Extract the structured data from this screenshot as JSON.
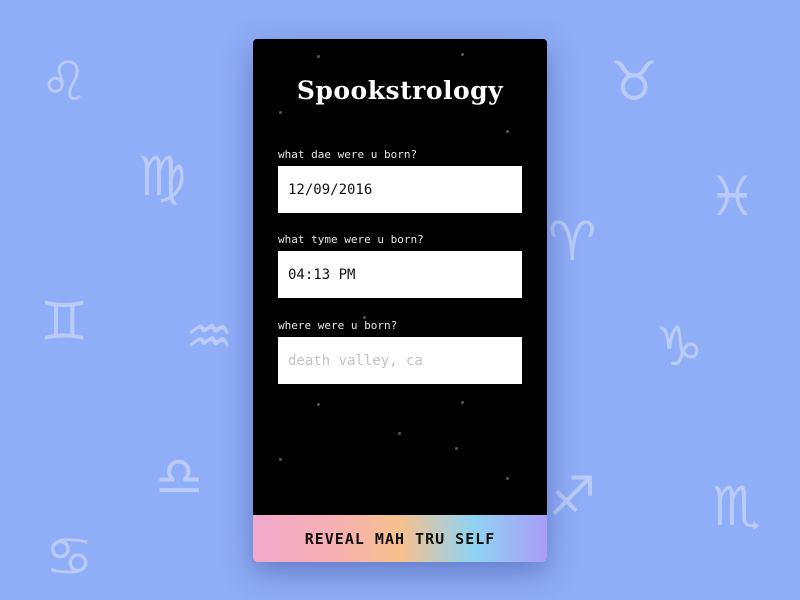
{
  "background": {
    "color": "#90adf7",
    "symbols": [
      {
        "name": "leo-icon",
        "glyph": "♌"
      },
      {
        "name": "virgo-icon",
        "glyph": "♍"
      },
      {
        "name": "gemini-icon",
        "glyph": "♊"
      },
      {
        "name": "aquarius-icon",
        "glyph": "♒"
      },
      {
        "name": "libra-icon",
        "glyph": "♎"
      },
      {
        "name": "cancer-icon",
        "glyph": "♋"
      },
      {
        "name": "taurus-icon",
        "glyph": "♉"
      },
      {
        "name": "pisces-icon",
        "glyph": "♓"
      },
      {
        "name": "aries-icon",
        "glyph": "♈"
      },
      {
        "name": "capricorn-icon",
        "glyph": "♑"
      },
      {
        "name": "sagittarius-icon",
        "glyph": "♐"
      },
      {
        "name": "scorpio-icon",
        "glyph": "♏"
      }
    ]
  },
  "app": {
    "title": "Spookstrology"
  },
  "form": {
    "date": {
      "label": "what dae were u born?",
      "value": "12/09/2016"
    },
    "time": {
      "label": "what tyme were u born?",
      "value": "04:13 PM"
    },
    "place": {
      "label": "where were u born?",
      "placeholder": "death valley, ca",
      "value": ""
    }
  },
  "submit": {
    "label": "REVEAL MAH TRU SELF"
  }
}
